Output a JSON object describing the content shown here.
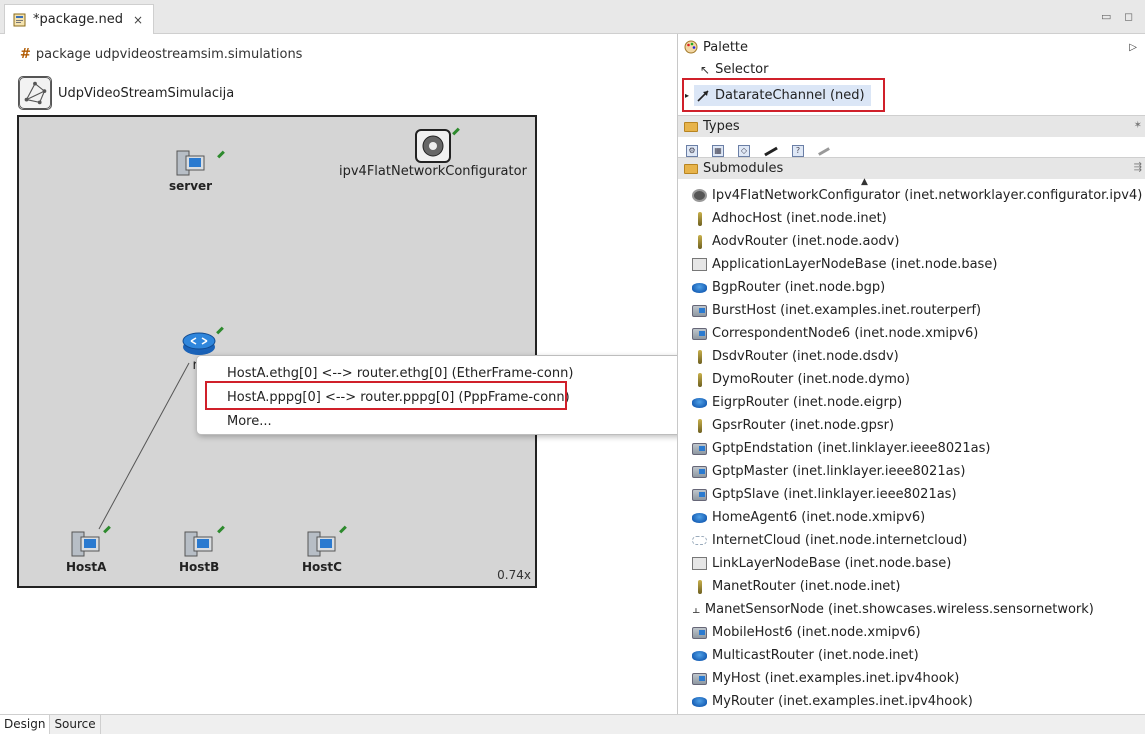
{
  "editor": {
    "tab_title": "*package.ned",
    "tab_close": "×",
    "package_line": "package udpvideostreamsim.simulations",
    "network_name": "UdpVideoStreamSimulacija",
    "zoom": "0.74x"
  },
  "nodes": {
    "server": "server",
    "configurator": "ipv4FlatNetworkConfigurator",
    "router": "ro",
    "hostA": "HostA",
    "hostB": "HostB",
    "hostC": "HostC"
  },
  "context_menu": {
    "items": [
      "HostA.ethg[0] <--> router.ethg[0] (EtherFrame-conn)",
      "HostA.pppg[0] <--> router.pppg[0] (PppFrame-conn)",
      "More..."
    ],
    "highlighted_index": 1,
    "highlight_color": "#d0202a"
  },
  "bottom_tabs": [
    "Design",
    "Source"
  ],
  "palette": {
    "title": "Palette",
    "selector": "Selector",
    "channel": "DatarateChannel (ned)",
    "types_label": "Types",
    "submodules_label": "Submodules",
    "submodules": [
      {
        "icon": "gear-icon",
        "label": "Ipv4FlatNetworkConfigurator (inet.networklayer.configurator.ipv4)"
      },
      {
        "icon": "antenna-icon",
        "label": "AdhocHost (inet.node.inet)"
      },
      {
        "icon": "antenna-icon",
        "label": "AodvRouter (inet.node.aodv)"
      },
      {
        "icon": "box-icon",
        "label": "ApplicationLayerNodeBase (inet.node.base)"
      },
      {
        "icon": "router-icon",
        "label": "BgpRouter (inet.node.bgp)"
      },
      {
        "icon": "host-icon",
        "label": "BurstHost (inet.examples.inet.routerperf)"
      },
      {
        "icon": "host-icon",
        "label": "CorrespondentNode6 (inet.node.xmipv6)"
      },
      {
        "icon": "antenna-icon",
        "label": "DsdvRouter (inet.node.dsdv)"
      },
      {
        "icon": "antenna-icon",
        "label": "DymoRouter (inet.node.dymo)"
      },
      {
        "icon": "router-icon",
        "label": "EigrpRouter (inet.node.eigrp)"
      },
      {
        "icon": "antenna-icon",
        "label": "GpsrRouter (inet.node.gpsr)"
      },
      {
        "icon": "host-icon",
        "label": "GptpEndstation (inet.linklayer.ieee8021as)"
      },
      {
        "icon": "host-icon",
        "label": "GptpMaster (inet.linklayer.ieee8021as)"
      },
      {
        "icon": "host-icon",
        "label": "GptpSlave (inet.linklayer.ieee8021as)"
      },
      {
        "icon": "router-icon",
        "label": "HomeAgent6 (inet.node.xmipv6)"
      },
      {
        "icon": "cloud-icon",
        "label": "InternetCloud (inet.node.internetcloud)"
      },
      {
        "icon": "box-icon",
        "label": "LinkLayerNodeBase (inet.node.base)"
      },
      {
        "icon": "antenna-icon",
        "label": "ManetRouter (inet.node.inet)"
      },
      {
        "icon": "sensor-icon",
        "label": "ManetSensorNode (inet.showcases.wireless.sensornetwork)"
      },
      {
        "icon": "host-icon",
        "label": "MobileHost6 (inet.node.xmipv6)"
      },
      {
        "icon": "router-icon",
        "label": "MulticastRouter (inet.node.inet)"
      },
      {
        "icon": "host-icon",
        "label": "MyHost (inet.examples.inet.ipv4hook)"
      },
      {
        "icon": "router-icon",
        "label": "MyRouter (inet.examples.inet.ipv4hook)"
      }
    ]
  }
}
